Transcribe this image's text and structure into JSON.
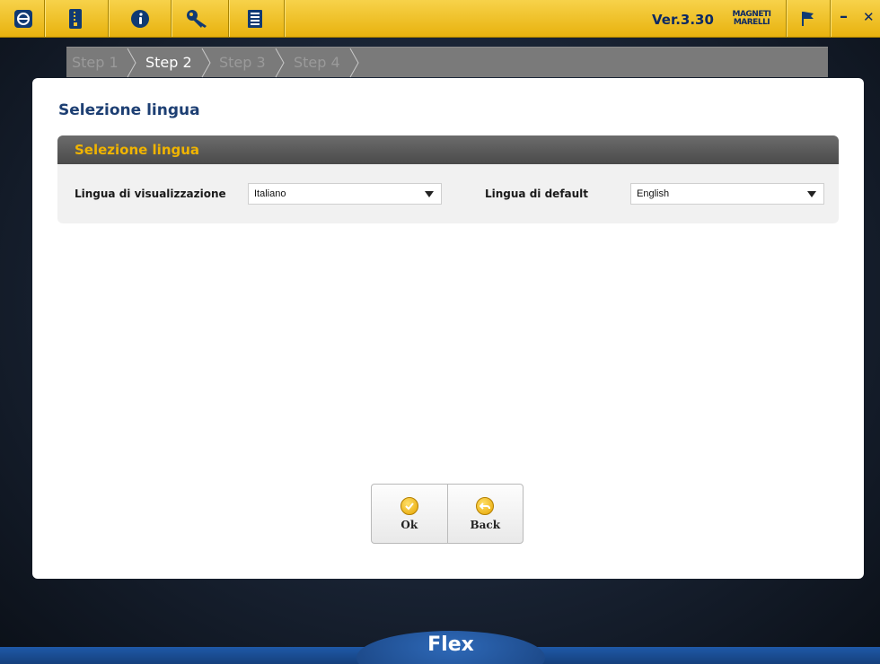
{
  "topbar": {
    "version": "Ver.3.30",
    "brand_line1": "MAGNETI",
    "brand_line2": "MARELLI",
    "minimize": "–",
    "close": "✕"
  },
  "steps": [
    "Step 1",
    "Step 2",
    "Step 3",
    "Step 4"
  ],
  "active_step": 1,
  "main": {
    "title": "Selezione lingua",
    "section_title": "Selezione lingua",
    "display_language_label": "Lingua di visualizzazione",
    "display_language_value": "Italiano",
    "default_language_label": "Lingua di default",
    "default_language_value": "English"
  },
  "buttons": {
    "ok_label": "Ok",
    "back_label": "Back"
  },
  "footer": {
    "product_name": "Flex"
  },
  "colors": {
    "accent_yellow": "#f0b400",
    "title_blue": "#1d3f73"
  }
}
